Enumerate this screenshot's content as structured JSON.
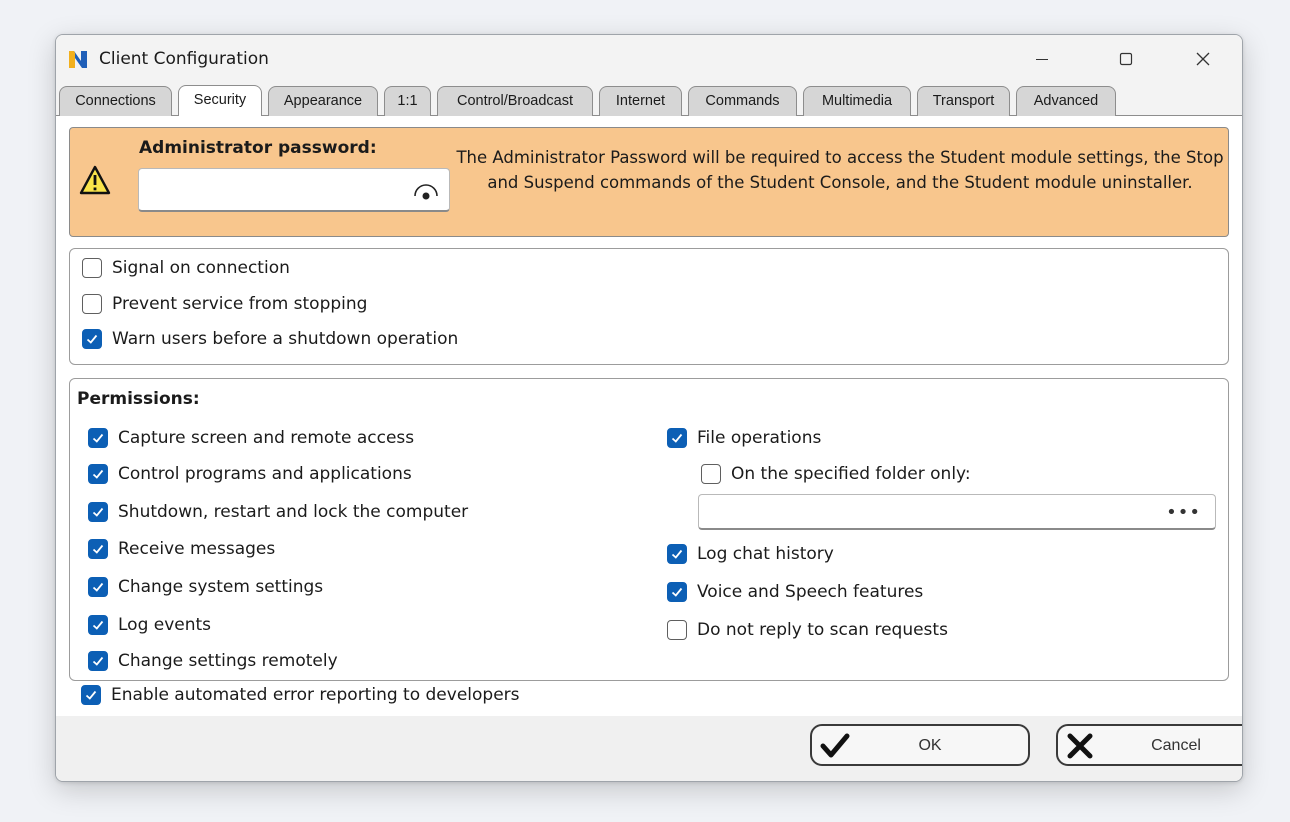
{
  "window": {
    "title": "Client Configuration",
    "controls": {
      "minimize": "—",
      "maximize": "□",
      "close": "✕"
    }
  },
  "tabs": [
    {
      "label": "Connections",
      "active": false
    },
    {
      "label": "Security",
      "active": true
    },
    {
      "label": "Appearance",
      "active": false
    },
    {
      "label": "1:1",
      "active": false
    },
    {
      "label": "Control/Broadcast",
      "active": false
    },
    {
      "label": "Internet",
      "active": false
    },
    {
      "label": "Commands",
      "active": false
    },
    {
      "label": "Multimedia",
      "active": false
    },
    {
      "label": "Transport",
      "active": false
    },
    {
      "label": "Advanced",
      "active": false
    }
  ],
  "admin": {
    "label": "Administrator password:",
    "password_value": "",
    "description": "The Administrator Password will be required to access the Student module settings, the Stop and Suspend commands of the Student Console, and the Student module uninstaller.",
    "warning_icon": "warning-triangle-icon",
    "reveal_icon": "eye-icon"
  },
  "options": [
    {
      "label": "Signal on connection",
      "checked": false
    },
    {
      "label": "Prevent service from stopping",
      "checked": false
    },
    {
      "label": "Warn users before a shutdown operation",
      "checked": true
    }
  ],
  "permissions": {
    "title": "Permissions:",
    "left": [
      {
        "label": "Capture screen and remote access",
        "checked": true
      },
      {
        "label": "Control programs and applications",
        "checked": true
      },
      {
        "label": "Shutdown, restart and lock the computer",
        "checked": true
      },
      {
        "label": "Receive messages",
        "checked": true
      },
      {
        "label": "Change system settings",
        "checked": true
      },
      {
        "label": "Log events",
        "checked": true
      },
      {
        "label": "Change settings remotely",
        "checked": true
      }
    ],
    "file_operations": {
      "label": "File operations",
      "checked": true
    },
    "folder_only": {
      "label": "On the specified folder only:",
      "checked": false
    },
    "folder_path": "",
    "browse_label": "•••",
    "right_more": [
      {
        "label": "Log chat history",
        "checked": true
      },
      {
        "label": "Voice and Speech features",
        "checked": true
      },
      {
        "label": "Do not reply to scan requests",
        "checked": false
      }
    ]
  },
  "error_reporting": {
    "label": "Enable automated error reporting to developers",
    "checked": true
  },
  "buttons": {
    "ok": "OK",
    "cancel": "Cancel"
  },
  "colors": {
    "accent": "#0c5fb5",
    "warning_bg": "#f8c68d"
  }
}
